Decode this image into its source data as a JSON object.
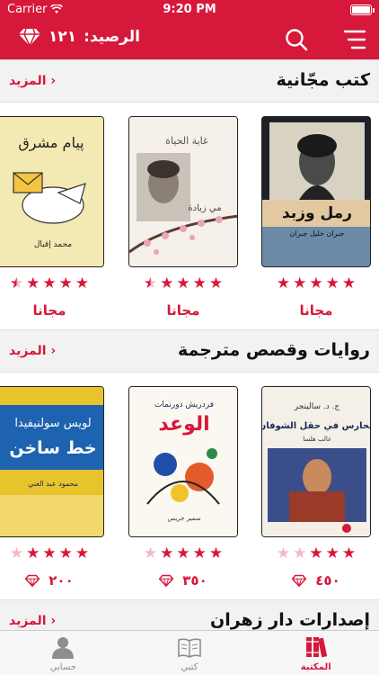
{
  "status": {
    "carrier": "Carrier",
    "time": "9:20 PM"
  },
  "nav": {
    "balance_label": "الرصيد:",
    "balance_value": "١٢١",
    "menu_icon": "hamburger-menu-icon",
    "search_icon": "search-icon",
    "wallet_icon": "diamond-icon"
  },
  "accent": "#d6183a",
  "sections": [
    {
      "title": "كتب مجّانية",
      "more": "المزيد",
      "books": [
        {
          "cover_title": "رمل وزبد",
          "cover_author": "جبران خليل جبران",
          "rating": 5,
          "price": "مجانا"
        },
        {
          "cover_title": "غاية الحياة",
          "cover_author": "مي زيادة",
          "rating": 4.5,
          "price": "مجانا"
        },
        {
          "cover_title": "پيام مشرق",
          "cover_author": "محمد إقبال",
          "rating": 4.5,
          "price": "مجانا"
        }
      ]
    },
    {
      "title": "روايات وقصص مترجمة",
      "more": "المزيد",
      "books": [
        {
          "cover_author": "ج. د. سالينجر",
          "cover_title": "الحارس في حقل الشوفان",
          "cover_translator": "غالب هلسا",
          "rating": 3,
          "price": "٤٥٠"
        },
        {
          "cover_author": "فردريش دورنمات",
          "cover_title": "الوعد",
          "cover_translator": "سمير جريس",
          "rating": 4,
          "price": "٣٥٠"
        },
        {
          "cover_author": "لويس سولنيفيدا",
          "cover_title": "خط ساخن",
          "cover_translator": "محمود عبد الغني",
          "rating": 4,
          "price": "٢٠٠"
        }
      ]
    },
    {
      "title": "إصدارات دار زهران",
      "more": "المزيد"
    }
  ],
  "tabs": [
    {
      "label": "حسابي",
      "icon": "user-icon"
    },
    {
      "label": "كتبي",
      "icon": "open-book-icon"
    },
    {
      "label": "المكتبة",
      "icon": "library-icon"
    }
  ]
}
